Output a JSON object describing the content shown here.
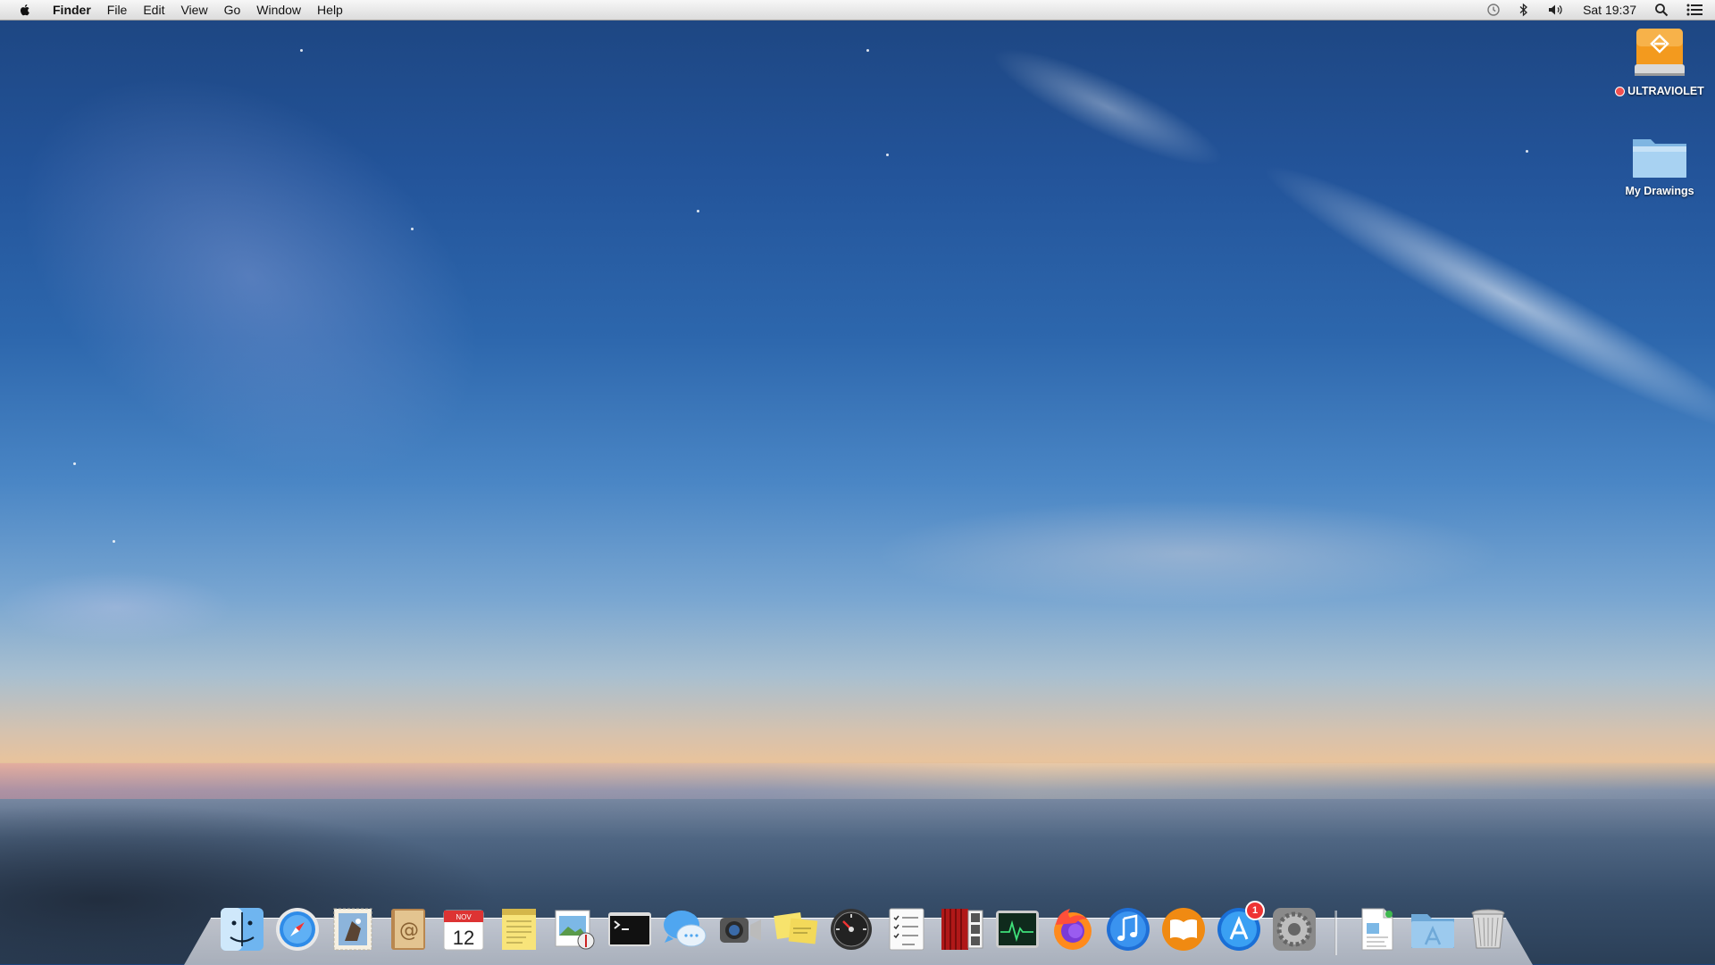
{
  "menubar": {
    "app_name": "Finder",
    "menus": [
      "File",
      "Edit",
      "View",
      "Go",
      "Window",
      "Help"
    ],
    "clock": "Sat 19:37",
    "status_icons": [
      "time-machine-icon",
      "bluetooth-icon",
      "volume-icon",
      "spotlight-icon",
      "notification-center-icon"
    ]
  },
  "desktop": {
    "drive": {
      "label": "ULTRAVIOLET",
      "tag_color": "#f05050",
      "icon_color": "#f39a1e"
    },
    "folder": {
      "label": "My Drawings",
      "icon_color": "#8fc3ea"
    }
  },
  "dock": {
    "apps": [
      "Finder",
      "Safari",
      "Mail",
      "Contacts",
      "Calendar",
      "Notes",
      "Preview",
      "Terminal",
      "Messages",
      "FaceTime",
      "Stickies",
      "Dashboard",
      "Reminders",
      "Photo Booth",
      "Activity Monitor",
      "Firefox",
      "iTunes",
      "iBooks",
      "App Store",
      "System Preferences"
    ],
    "calendar": {
      "month": "NOV",
      "day": "12"
    },
    "app_store_badge": "1",
    "stacks": [
      "Documents",
      "Applications",
      "Trash"
    ]
  },
  "colors": {
    "menubar_bg": "#e8e8e8",
    "accent_blue": "#2d67ad"
  }
}
